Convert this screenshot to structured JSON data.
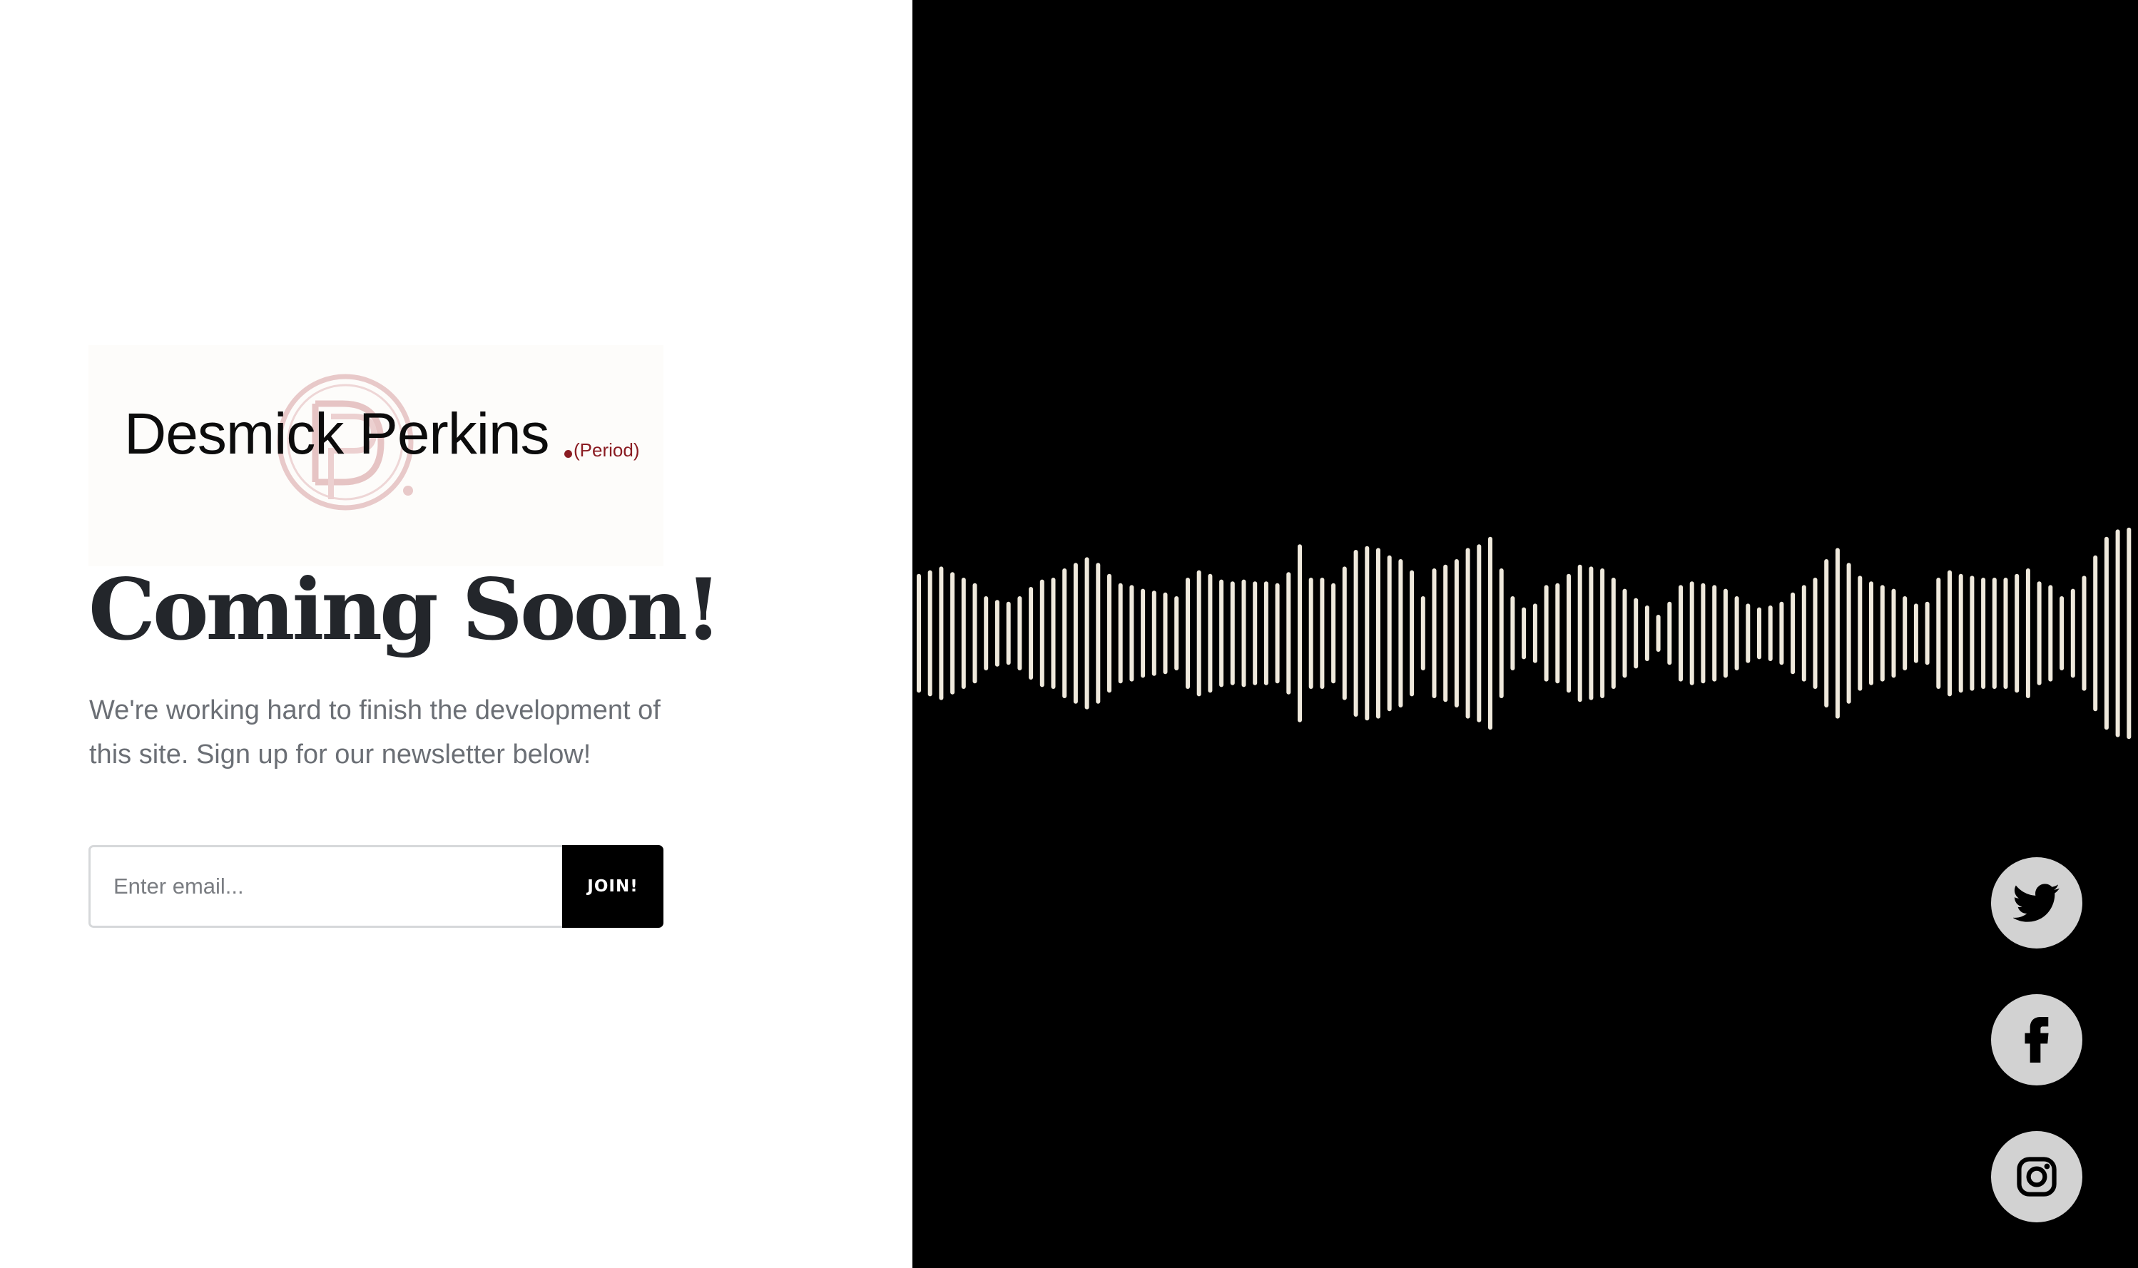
{
  "brand": {
    "name": "Desmick Perkins",
    "suffix": "(Period)",
    "monogram": "DP",
    "accent_color": "#8a1c22",
    "monogram_color": "#e8c9c9"
  },
  "hero": {
    "headline": "Coming Soon!",
    "subtext": "We're working hard to finish the development of this site. Sign up for our newsletter below!"
  },
  "newsletter": {
    "email_placeholder": "Enter email...",
    "join_label": "JOIN!"
  },
  "visual": {
    "type": "audio-waveform",
    "bar_color": "#efe9dc",
    "background": "#000000",
    "bar_levels": [
      0.32,
      0.34,
      0.36,
      0.33,
      0.3,
      0.27,
      0.2,
      0.18,
      0.17,
      0.2,
      0.25,
      0.29,
      0.3,
      0.35,
      0.38,
      0.41,
      0.38,
      0.32,
      0.27,
      0.26,
      0.24,
      0.23,
      0.22,
      0.2,
      0.3,
      0.34,
      0.32,
      0.29,
      0.28,
      0.29,
      0.28,
      0.28,
      0.27,
      0.33,
      0.48,
      0.3,
      0.3,
      0.27,
      0.36,
      0.45,
      0.47,
      0.46,
      0.42,
      0.4,
      0.34,
      0.2,
      0.35,
      0.37,
      0.4,
      0.46,
      0.48,
      0.52,
      0.35,
      0.2,
      0.14,
      0.16,
      0.26,
      0.27,
      0.32,
      0.37,
      0.36,
      0.35,
      0.3,
      0.24,
      0.19,
      0.15,
      0.1,
      0.17,
      0.26,
      0.28,
      0.27,
      0.26,
      0.24,
      0.2,
      0.16,
      0.14,
      0.15,
      0.17,
      0.22,
      0.26,
      0.3,
      0.4,
      0.46,
      0.38,
      0.31,
      0.28,
      0.26,
      0.24,
      0.2,
      0.16,
      0.17,
      0.3,
      0.34,
      0.32,
      0.31,
      0.3,
      0.3,
      0.3,
      0.32,
      0.35,
      0.28,
      0.26,
      0.2,
      0.24,
      0.31,
      0.42,
      0.52,
      0.56,
      0.57
    ]
  },
  "social": [
    {
      "name": "twitter",
      "icon": "twitter-icon"
    },
    {
      "name": "facebook",
      "icon": "facebook-icon"
    },
    {
      "name": "instagram",
      "icon": "instagram-icon"
    }
  ]
}
